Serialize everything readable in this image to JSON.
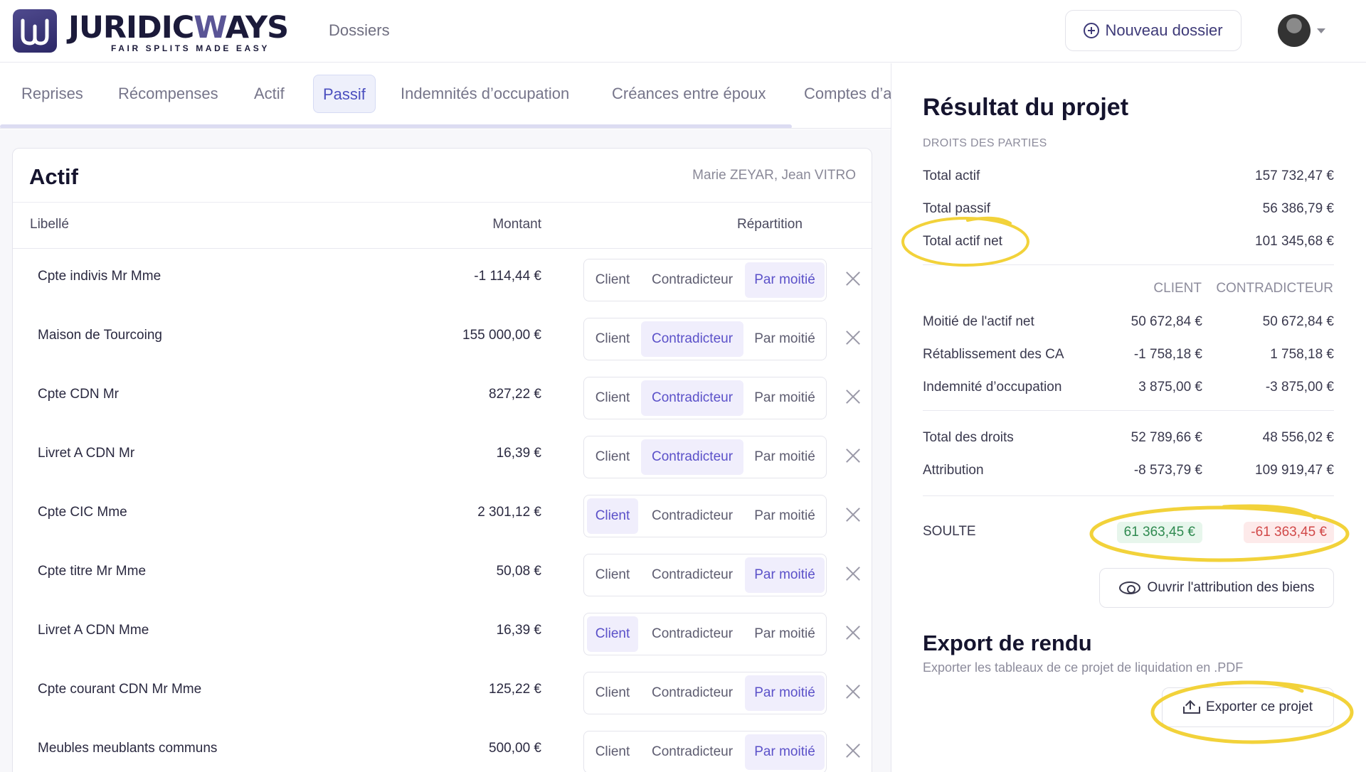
{
  "header": {
    "brand": "JURIDICWAYS",
    "brand_prefix": "JURIDIC",
    "brand_accent": "W",
    "brand_suffix": "AYS",
    "tagline": "FAIR SPLITS MADE EASY",
    "nav_dossiers": "Dossiers",
    "new_folder_label": "Nouveau dossier"
  },
  "tabs": [
    {
      "label": "Reprises"
    },
    {
      "label": "Récompenses"
    },
    {
      "label": "Actif"
    },
    {
      "label": "Passif",
      "active": true
    },
    {
      "label": "Indemnités d’occupation"
    },
    {
      "label": "Créances entre époux"
    },
    {
      "label": "Comptes d’a"
    }
  ],
  "card": {
    "title": "Actif",
    "parties": "Marie ZEYAR, Jean VITRO",
    "columns": {
      "label": "Libellé",
      "amount": "Montant",
      "split": "Répartition"
    },
    "options": {
      "client": "Client",
      "contradicteur": "Contradicteur",
      "moitie": "Par moitié"
    },
    "rows": [
      {
        "label": "Cpte indivis Mr Mme",
        "amount": "-1 114,44 €",
        "selected": "moitie"
      },
      {
        "label": "Maison de Tourcoing",
        "amount": "155 000,00 €",
        "selected": "contradicteur"
      },
      {
        "label": "Cpte CDN Mr",
        "amount": "827,22 €",
        "selected": "contradicteur"
      },
      {
        "label": "Livret A CDN Mr",
        "amount": "16,39 €",
        "selected": "contradicteur"
      },
      {
        "label": "Cpte CIC Mme",
        "amount": "2 301,12 €",
        "selected": "client"
      },
      {
        "label": "Cpte titre Mr Mme",
        "amount": "50,08 €",
        "selected": "moitie"
      },
      {
        "label": "Livret A CDN Mme",
        "amount": "16,39 €",
        "selected": "client"
      },
      {
        "label": "Cpte courant CDN Mr Mme",
        "amount": "125,22 €",
        "selected": "moitie"
      },
      {
        "label": "Meubles meublants communs",
        "amount": "500,00 €",
        "selected": "moitie"
      }
    ]
  },
  "result": {
    "title": "Résultat du projet",
    "subtitle": "DROITS DES PARTIES",
    "totals": [
      {
        "label": "Total actif",
        "value": "157 732,47 €"
      },
      {
        "label": "Total passif",
        "value": "56 386,79 €"
      },
      {
        "label": "Total actif net",
        "value": "101 345,68 €"
      }
    ],
    "col_client": "CLIENT",
    "col_contradicteur": "CONTRADICTEUR",
    "lines": [
      {
        "label": "Moitié de l'actif net",
        "client": "50 672,84 €",
        "contradicteur": "50 672,84 €"
      },
      {
        "label": "Rétablissement des CA",
        "client": "-1 758,18 €",
        "contradicteur": "1 758,18 €"
      },
      {
        "label": "Indemnité d’occupation",
        "client": "3 875,00 €",
        "contradicteur": "-3 875,00 €"
      }
    ],
    "lines2": [
      {
        "label": "Total des droits",
        "client": "52 789,66 €",
        "contradicteur": "48 556,02 €"
      },
      {
        "label": "Attribution",
        "client": "-8 573,79 €",
        "contradicteur": "109 919,47 €"
      }
    ],
    "soulte": {
      "label": "SOULTE",
      "client": "61 363,45 €",
      "contradicteur": "-61 363,45 €"
    },
    "open_button": "Ouvrir l'attribution des biens",
    "export_title": "Export de rendu",
    "export_desc": "Exporter les tableaux de ce projet de liquidation en .PDF",
    "export_button": "Exporter ce projet"
  },
  "colors": {
    "accent": "#5b51c9",
    "highlight": "#f2d23a",
    "positive": "#2f8a50",
    "negative": "#d14848"
  },
  "icons": [
    "logo-icon",
    "plus-circle-icon",
    "avatar",
    "chevron-down-icon",
    "close-icon",
    "eye-icon",
    "upload-icon"
  ]
}
